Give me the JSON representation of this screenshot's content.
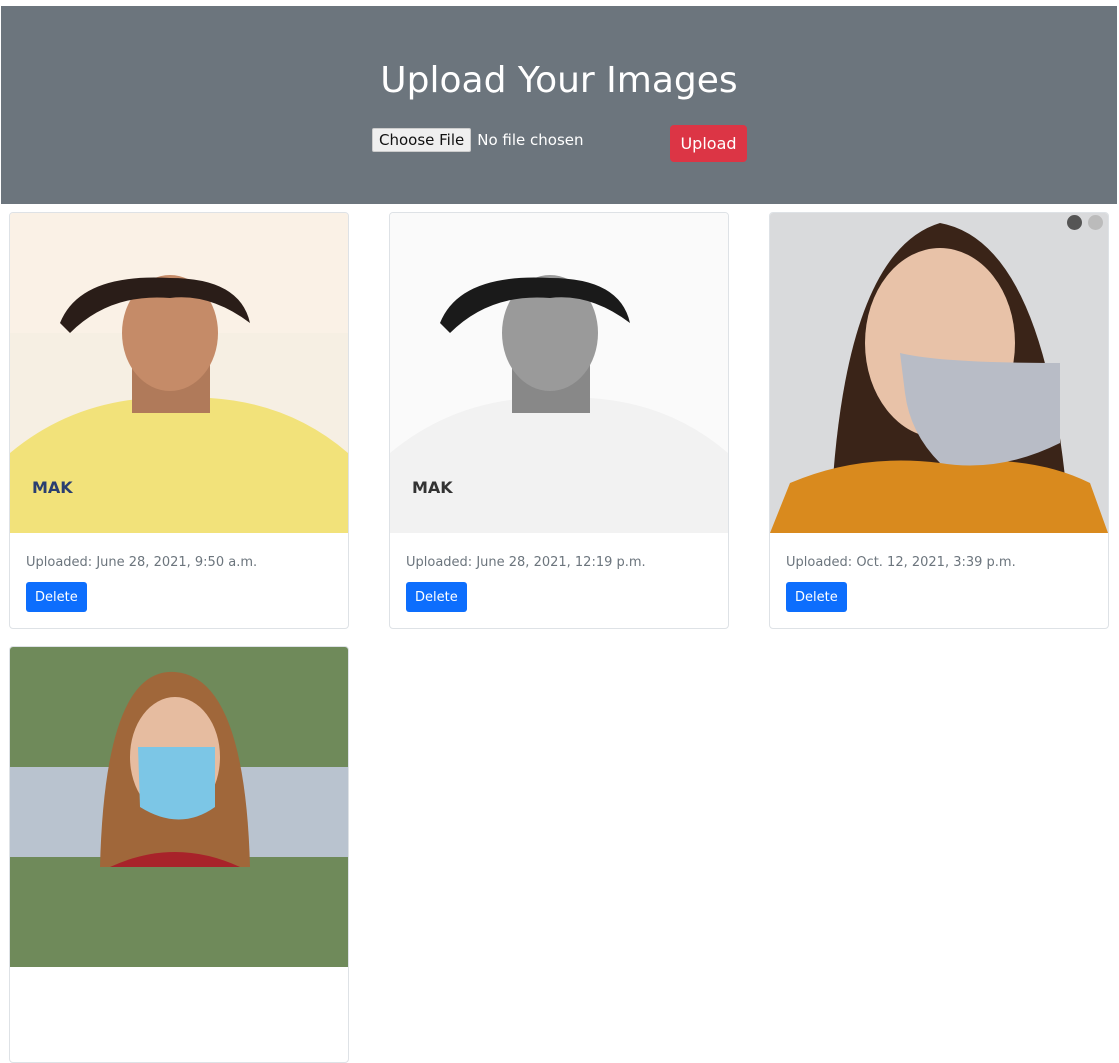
{
  "header": {
    "title": "Upload Your Images",
    "choose_file_label": "Choose File",
    "file_status": "No file chosen",
    "upload_label": "Upload",
    "background": "#6c757d",
    "upload_color": "#dc3545"
  },
  "images": [
    {
      "caption": "Uploaded: June 28, 2021, 9:50 a.m.",
      "delete_label": "Delete"
    },
    {
      "caption": "Uploaded: June 28, 2021, 12:19 p.m.",
      "delete_label": "Delete"
    },
    {
      "caption": "Uploaded: Oct. 12, 2021, 3:39 p.m.",
      "delete_label": "Delete"
    },
    {
      "caption": "",
      "delete_label": ""
    }
  ],
  "delete_color": "#0d6efd"
}
